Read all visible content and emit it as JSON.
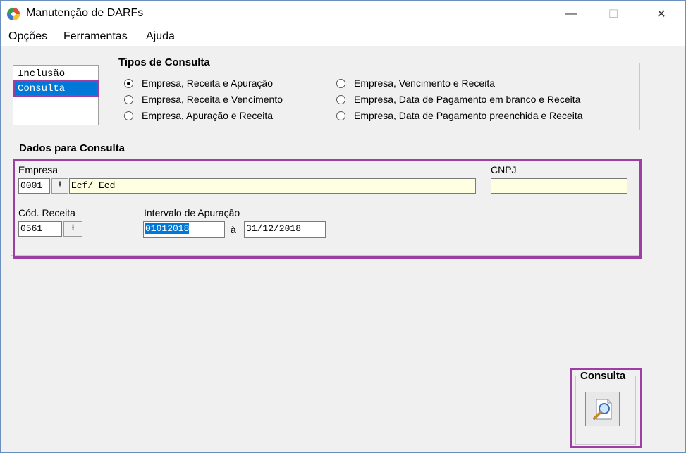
{
  "window": {
    "title": "Manutenção de DARFs",
    "min_label": "—",
    "max_label": "☐",
    "close_label": "✕"
  },
  "menu": {
    "items": [
      {
        "label": "Opções"
      },
      {
        "label": "Ferramentas"
      },
      {
        "label": "Ajuda"
      }
    ]
  },
  "modes": {
    "items": [
      {
        "label": "Inclusão"
      },
      {
        "label": "Consulta"
      }
    ],
    "selected": "Consulta"
  },
  "tipos": {
    "title": "Tipos de Consulta",
    "options": [
      {
        "label": "Empresa, Receita e Apuração",
        "checked": true
      },
      {
        "label": "Empresa, Receita e Vencimento",
        "checked": false
      },
      {
        "label": "Empresa, Apuração e Receita",
        "checked": false
      },
      {
        "label": "Empresa, Vencimento e Receita",
        "checked": false
      },
      {
        "label": "Empresa, Data de Pagamento em branco e Receita",
        "checked": false
      },
      {
        "label": "Empresa, Data de Pagamento preenchida e Receita",
        "checked": false
      }
    ]
  },
  "dados": {
    "title": "Dados para Consulta",
    "empresa_label": "Empresa",
    "empresa_code": "0001",
    "empresa_name": "Ecf/ Ecd",
    "cnpj_label": "CNPJ",
    "cnpj_value": "",
    "receita_label": "Cód. Receita",
    "receita_code": "0561",
    "intervalo_label": "Intervalo de Apuração",
    "date_from": "01012018",
    "date_sep": "à",
    "date_to": "31/12/2018",
    "dropdown_glyph": "⭳"
  },
  "consulta": {
    "title": "Consulta"
  },
  "colors": {
    "highlight": "#9b3fa3",
    "selection": "#0078d7",
    "field_yellow": "#ffffe1"
  }
}
